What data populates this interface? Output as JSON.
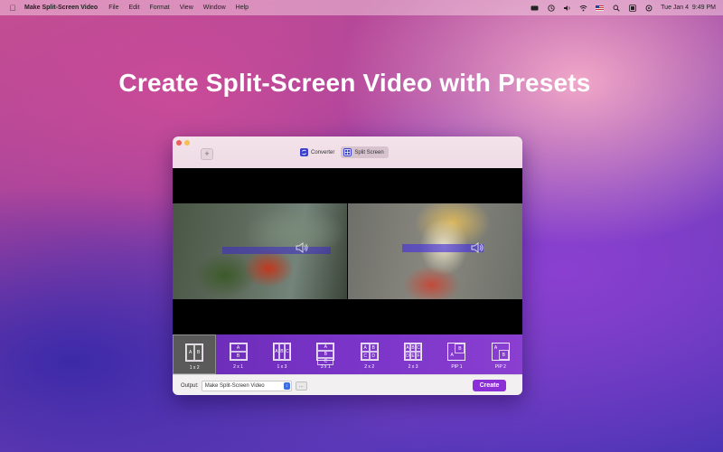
{
  "menubar": {
    "app_name": "Make Split-Screen Video",
    "menus": [
      "File",
      "Edit",
      "Format",
      "View",
      "Window",
      "Help"
    ],
    "status_icons": [
      "keyboard-icon",
      "time-machine-icon",
      "volume-icon",
      "wifi-icon",
      "flag-icon",
      "search-icon",
      "display-icon",
      "control-center-icon"
    ],
    "clock": "Tue Jan 4  9:49 PM"
  },
  "headline": "Create Split-Screen Video with Presets",
  "window": {
    "add_button": "+",
    "tabs": [
      {
        "label": "Converter",
        "icon": "converter-icon",
        "active": false
      },
      {
        "label": "Split Screen",
        "icon": "split-screen-icon",
        "active": true
      }
    ],
    "presets": [
      {
        "label": "1 x 2",
        "cells": [
          "A",
          "B"
        ],
        "cols": 2,
        "rows": 1,
        "selected": true
      },
      {
        "label": "2 x 1",
        "cells": [
          "A",
          "B"
        ],
        "cols": 1,
        "rows": 2,
        "selected": false
      },
      {
        "label": "1 x 3",
        "cells": [
          "A",
          "B",
          "C"
        ],
        "cols": 3,
        "rows": 1,
        "selected": false
      },
      {
        "label": "3 x 1",
        "cells": [
          "A",
          "B",
          "C"
        ],
        "cols": 1,
        "rows": 3,
        "selected": false
      },
      {
        "label": "2 x 2",
        "cells": [
          "A",
          "B",
          "C",
          "D"
        ],
        "cols": 2,
        "rows": 2,
        "selected": false
      },
      {
        "label": "2 x 3",
        "cells": [
          "A",
          "B",
          "C",
          "D",
          "E",
          "F"
        ],
        "cols": 3,
        "rows": 2,
        "selected": false
      },
      {
        "label": "PIP 1",
        "cells": [
          "A",
          "B"
        ],
        "pip": true,
        "selected": false
      },
      {
        "label": "PIP 2",
        "cells": [
          "A",
          "B"
        ],
        "pip": true,
        "selected": false
      }
    ],
    "footer": {
      "output_label": "Output:",
      "output_value": "Make Split-Screen Video",
      "browse_label": "…",
      "create_label": "Create"
    }
  }
}
